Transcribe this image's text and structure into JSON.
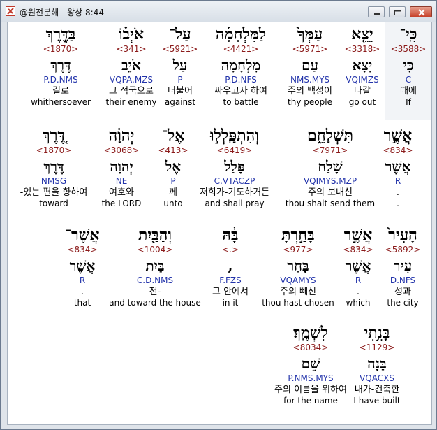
{
  "window": {
    "title": "@원전분해 - 왕상 8:44"
  },
  "icons": {
    "app": "app-logo-icon",
    "minimize": "minimize-icon",
    "maximize": "maximize-icon",
    "close": "close-icon"
  },
  "colors": {
    "strong": "#8b1a1a",
    "parse": "#2233aa"
  },
  "rows": [
    [
      {
        "heb": "כִּֽי־",
        "strong": "<3588>",
        "lemma": "כִּי",
        "parse": "C",
        "kor": "때에",
        "eng": "If"
      },
      {
        "heb": "יֵצֵ֤א",
        "strong": "<3318>",
        "lemma": "יָצָא",
        "parse": "VQIMZS",
        "kor": "나갈",
        "eng": "go out"
      },
      {
        "heb": "עַמְּךָ֙",
        "strong": "<5971>",
        "lemma": "עַם",
        "parse": "NMS.MYS",
        "kor": "주의 백성이",
        "eng": "thy people"
      },
      {
        "heb": "לַמִּלְחָמָ֜ה",
        "strong": "<4421>",
        "lemma": "מִלְחָמָה",
        "parse": "P.D.NFS",
        "kor": "싸우고자 하여",
        "eng": "to battle"
      },
      {
        "heb": "עַל־",
        "strong": "<5921>",
        "lemma": "עַל",
        "parse": "P",
        "kor": "더불어",
        "eng": "against"
      },
      {
        "heb": "אֹיְב֗וֹ",
        "strong": "<341>",
        "lemma": "אֹיֵב",
        "parse": "VQPA.MZS",
        "kor": "그 적국으로",
        "eng": "their enemy"
      },
      {
        "heb": "בַּדֶּ֖רֶךְ",
        "strong": "<1870>",
        "lemma": "דֶּרֶךְ",
        "parse": "P.D.NMS",
        "kor": "길로",
        "eng": "whithersoever"
      }
    ],
    [
      {
        "heb": "אֲשֶׁ֣ר",
        "strong": "<834>",
        "lemma": "אֲשֶׁר",
        "parse": "R",
        "kor": ".",
        "eng": "."
      },
      {
        "heb": "תִּשְׁלָחֵ֑ם",
        "strong": "<7971>",
        "lemma": "שָׁלַח",
        "parse": "VQIMYS.MZP",
        "kor": "주의 보내신",
        "eng": "thou shalt send them"
      },
      {
        "heb": "וְהִתְפַּֽלְל֣וּ",
        "strong": "<6419>",
        "lemma": "פָּלַל",
        "parse": "C.VTACZP",
        "kor": "저희가-기도하거든",
        "eng": "and shall pray"
      },
      {
        "heb": "אֶל־",
        "strong": "<413>",
        "lemma": "אֶל",
        "parse": "P",
        "kor": "께",
        "eng": "unto"
      },
      {
        "heb": "יְהוָ֗ה",
        "strong": "<3068>",
        "lemma": "יְהוָה",
        "parse": "NE",
        "kor": "여호와",
        "eng": "the LORD"
      },
      {
        "heb": "דֶּ֚רֶךְ",
        "strong": "<1870>",
        "lemma": "דֶּרֶךְ",
        "parse": "NMSG",
        "kor": "-있는 편을 향하여",
        "eng": "toward"
      }
    ],
    [
      {
        "heb": "הָעִיר֙",
        "strong": "<5892>",
        "lemma": "עִיר",
        "parse": "D.NFS",
        "kor": "성과",
        "eng": "the city"
      },
      {
        "heb": "אֲשֶׁ֣ר",
        "strong": "<834>",
        "lemma": "אֲשֶׁר",
        "parse": "R",
        "kor": ".",
        "eng": "which"
      },
      {
        "heb": "בָּחַ֣רְתָּ",
        "strong": "<977>",
        "lemma": "בָּחַר",
        "parse": "VQAMYS",
        "kor": "주의 빼신",
        "eng": "thou hast chosen"
      },
      {
        "heb": "בָּ֔הּ",
        "strong": "<.>",
        "lemma": ",",
        "parse": "F.FZS",
        "kor": "그 안에서",
        "eng": "in it"
      },
      {
        "heb": "וְהַבַּ֖יִת",
        "strong": "<1004>",
        "lemma": "בַּיִת",
        "parse": "C.D.NMS",
        "kor": "전-",
        "eng": "and toward the house"
      },
      {
        "heb": "אֲשֶׁר־",
        "strong": "<834>",
        "lemma": "אֲשֶׁר",
        "parse": "R",
        "kor": ".",
        "eng": "that"
      }
    ],
    [
      {
        "heb": "בָּנִ֥תִי",
        "strong": "<1129>",
        "lemma": "בָּנָה",
        "parse": "VQACXS",
        "kor": "내가-건축한",
        "eng": "I have built"
      },
      {
        "heb": "לִשְׁמֶֽךָ׃",
        "strong": "<8034>",
        "lemma": "שֵׁם",
        "parse": "P.NMS.MYS",
        "kor": "주의 이름을 위하여",
        "eng": "for the name"
      }
    ]
  ]
}
